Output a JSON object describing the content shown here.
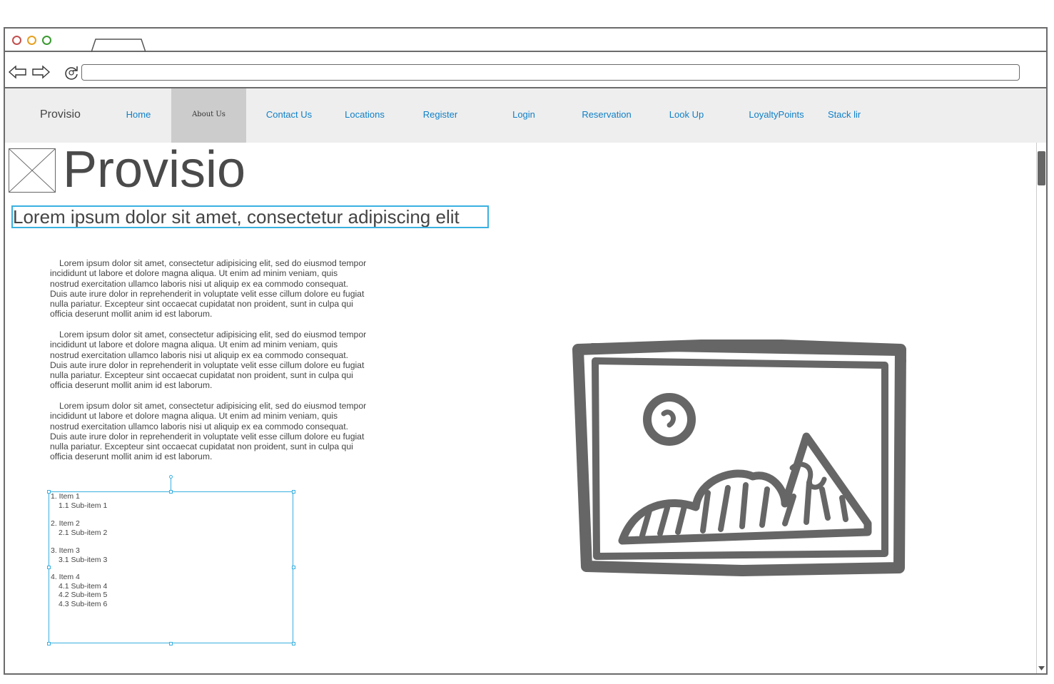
{
  "browser": {
    "url": ""
  },
  "nav": {
    "brand": "Provisio",
    "items": [
      "Home",
      "About Us",
      "Contact Us",
      "Locations",
      "Register",
      "Login",
      "Reservation",
      "Look Up",
      "LoyaltyPoints",
      "Stack lir"
    ],
    "active_index": 1
  },
  "hero": {
    "title": "Provisio",
    "subtitle": "Lorem ipsum dolor sit amet, consectetur adipiscing elit"
  },
  "paragraphs": [
    "Lorem ipsum dolor sit amet, consectetur adipisicing elit, sed do eiusmod tempor incididunt ut labore et dolore magna aliqua. Ut enim ad minim veniam, quis nostrud exercitation ullamco laboris nisi ut aliquip ex ea commodo consequat. Duis aute irure dolor in reprehenderit in voluptate velit esse cillum dolore eu fugiat nulla pariatur. Excepteur sint occaecat cupidatat non proident, sunt in culpa qui officia deserunt mollit anim id est laborum.",
    "Lorem ipsum dolor sit amet, consectetur adipisicing elit, sed do eiusmod tempor incididunt ut labore et dolore magna aliqua. Ut enim ad minim veniam, quis nostrud exercitation ullamco laboris nisi ut aliquip ex ea commodo consequat. Duis aute irure dolor in reprehenderit in voluptate velit esse cillum dolore eu fugiat nulla pariatur. Excepteur sint occaecat cupidatat non proident, sunt in culpa qui officia deserunt mollit anim id est laborum.",
    "Lorem ipsum dolor sit amet, consectetur adipisicing elit, sed do eiusmod tempor incididunt ut labore et dolore magna aliqua. Ut enim ad minim veniam, quis nostrud exercitation ullamco laboris nisi ut aliquip ex ea commodo consequat. Duis aute irure dolor in reprehenderit in voluptate velit esse cillum dolore eu fugiat nulla pariatur. Excepteur sint occaecat cupidatat non proident, sunt in culpa qui officia deserunt mollit anim id est laborum."
  ],
  "list": {
    "items": [
      {
        "label": "1. Item 1",
        "subs": [
          "1.1 Sub-item 1"
        ]
      },
      {
        "label": "2. Item 2",
        "subs": [
          "2.1 Sub-item 2"
        ]
      },
      {
        "label": "3. Item 3",
        "subs": [
          "3.1 Sub-item 3"
        ]
      },
      {
        "label": "4. Item 4",
        "subs": [
          "4.1 Sub-item 4",
          "4.2 Sub-item 5",
          "4.3 Sub-item 6"
        ]
      }
    ]
  },
  "icons": {
    "back": "back-arrow-icon",
    "forward": "forward-arrow-icon",
    "reload": "reload-icon",
    "image_placeholder": "image-placeholder-icon",
    "logo_placeholder": "logo-placeholder-icon"
  },
  "colors": {
    "link": "#1080c8",
    "selection": "#3ab0e0",
    "nav_bg": "#eeeeee",
    "nav_active_bg": "#cccccc",
    "close_dot": "#c0504d",
    "minimize_dot": "#e6a020",
    "zoom_dot": "#3a9a30"
  }
}
